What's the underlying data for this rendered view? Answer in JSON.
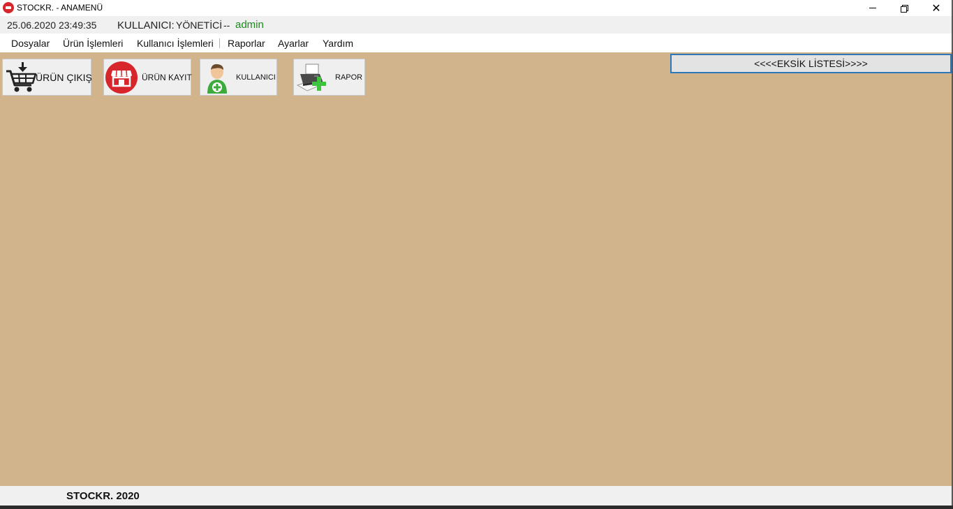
{
  "window": {
    "title": "STOCKR. - ANAMENÜ",
    "controls": {
      "minimize_icon": "minimize-icon",
      "maximize_icon": "restore-icon",
      "close_icon": "close-icon"
    }
  },
  "infobar": {
    "datetime": "25.06.2020 23:49:35",
    "user_label": "KULLANICI:",
    "user_role": "YÖNETİCİ",
    "separator": "--",
    "user_name": "admin"
  },
  "menu": {
    "items": [
      "Dosyalar",
      "Ürün İşlemleri",
      "Kullanıcı İşlemleri",
      "Raporlar",
      "Ayarlar",
      "Yardım"
    ]
  },
  "toolbar": {
    "buttons": [
      {
        "label": "ÜRÜN ÇIKIŞ",
        "icon": "shopping-cart-icon"
      },
      {
        "label": "ÜRÜN KAYIT",
        "icon": "store-icon"
      },
      {
        "label": "KULLANICI",
        "icon": "add-user-icon"
      },
      {
        "label": "RAPOR",
        "icon": "printer-add-icon"
      }
    ],
    "eksik_label": "<<<<EKSİK LİSTESİ>>>>"
  },
  "footer": {
    "text": "STOCKR. 2020"
  },
  "colors": {
    "content_bg": "#d2b48c",
    "bar_bg": "#f0f0f0",
    "accent_border": "#2f78b8",
    "user_name": "#1b8a1b",
    "app_icon": "#d7262b"
  }
}
